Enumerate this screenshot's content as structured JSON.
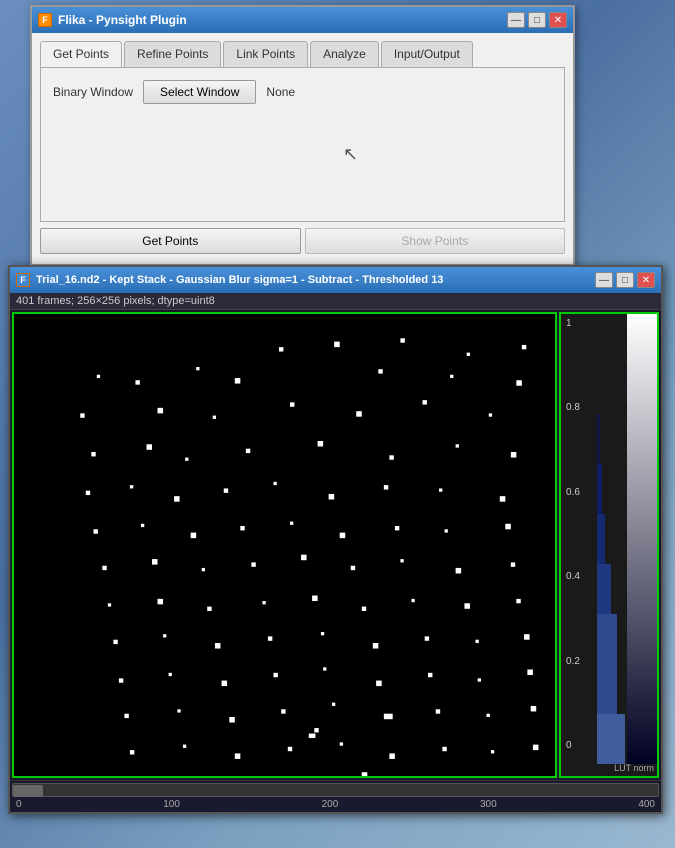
{
  "plugin_window": {
    "title": "Flika - Pynsight Plugin",
    "tabs": [
      {
        "label": "Get Points",
        "active": true
      },
      {
        "label": "Refine Points",
        "active": false
      },
      {
        "label": "Link Points",
        "active": false
      },
      {
        "label": "Analyze",
        "active": false
      },
      {
        "label": "Input/Output",
        "active": false
      }
    ],
    "binary_window_label": "Binary Window",
    "select_window_btn": "Select Window",
    "none_label": "None",
    "get_points_btn": "Get Points",
    "show_points_btn": "Show Points",
    "win_controls": {
      "minimize": "—",
      "maximize": "□",
      "close": "✕"
    }
  },
  "image_window": {
    "title": "Trial_16.nd2 - Kept Stack - Gaussian Blur sigma=1 - Subtract - Thresholded 13",
    "info": "401 frames; 256×256 pixels; dtype=uint8",
    "win_controls": {
      "minimize": "—",
      "maximize": "□",
      "close": "✕"
    },
    "lut_labels": [
      "1",
      "0.8",
      "0.6",
      "0.4",
      "0.2",
      "0"
    ],
    "lut_norm": "LUT norm",
    "x_axis": [
      "0",
      "100",
      "200",
      "300",
      "400"
    ]
  }
}
